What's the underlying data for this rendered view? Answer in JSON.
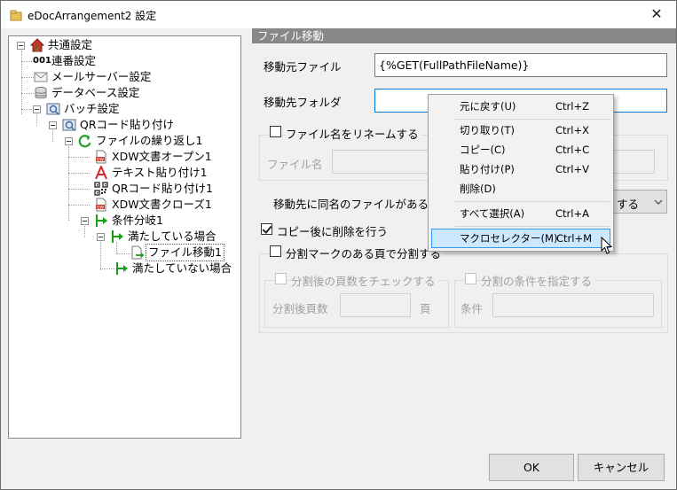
{
  "window": {
    "title": "eDocArrangement2 設定",
    "close_glyph": "✕"
  },
  "tree": {
    "items": [
      {
        "label": "共通設定",
        "icon": "common-settings-icon"
      },
      {
        "label": "連番設定",
        "icon_text": "001",
        "icon": "serial-number-icon"
      },
      {
        "label": "メールサーバー設定",
        "icon": "mail-icon"
      },
      {
        "label": "データベース設定",
        "icon": "database-icon"
      },
      {
        "label": "バッチ設定",
        "icon": "batch-icon"
      },
      {
        "label": "QRコード貼り付け",
        "icon": "batch-icon"
      },
      {
        "label": "ファイルの繰り返し1",
        "icon": "loop-icon"
      },
      {
        "label": "XDW文書オープン1",
        "icon": "xdw-doc-icon"
      },
      {
        "label": "テキスト貼り付け1",
        "icon": "text-a-icon"
      },
      {
        "label": "QRコード貼り付け1",
        "icon": "qr-code-icon"
      },
      {
        "label": "XDW文書クローズ1",
        "icon": "xdw-doc-icon"
      },
      {
        "label": "条件分岐1",
        "icon": "branch-icon"
      },
      {
        "label": "満たしている場合",
        "icon": "branch-icon"
      },
      {
        "label": "ファイル移動1",
        "icon": "file-move-icon"
      },
      {
        "label": "満たしていない場合",
        "icon": "branch-icon"
      }
    ]
  },
  "panel": {
    "header": "ファイル移動",
    "source_file_label": "移動元ファイル",
    "source_file_value": "{%GET(FullPathFileName)}",
    "dest_folder_label": "移動先フォルダ",
    "dest_folder_value": "",
    "rename_checkbox_label": "ファイル名をリネームする",
    "rename_checked": false,
    "filename_label": "ファイル名",
    "same_name_label": "移動先に同名のファイルがある",
    "same_name_combo_value": "する",
    "delete_after_copy_label": "コピー後に削除を行う",
    "delete_after_copy_checked": true,
    "split_checkbox_label": "分割マークのある頁で分割する",
    "split_checked": false,
    "check_pages_label": "分割後の頁数をチェックする",
    "pages_after_split_label": "分割後頁数",
    "page_unit": "頁",
    "split_condition_label": "分割の条件を指定する",
    "condition_label": "条件"
  },
  "buttons": {
    "ok": "OK",
    "cancel": "キャンセル"
  },
  "context_menu": {
    "items": [
      {
        "label": "元に戻す(U)",
        "shortcut": "Ctrl+Z"
      },
      {
        "label": "切り取り(T)",
        "shortcut": "Ctrl+X"
      },
      {
        "label": "コピー(C)",
        "shortcut": "Ctrl+C"
      },
      {
        "label": "貼り付け(P)",
        "shortcut": "Ctrl+V"
      },
      {
        "label": "削除(D)",
        "shortcut": ""
      },
      {
        "label": "すべて選択(A)",
        "shortcut": "Ctrl+A"
      },
      {
        "label": "マクロセレクター(M)",
        "shortcut": "Ctrl+M"
      }
    ],
    "highlighted_index": 6
  },
  "colors": {
    "section_header_bg": "#888888",
    "menu_highlight": "#cce8ff",
    "menu_highlight_border": "#3399ff",
    "branch_green": "#1a9e1a",
    "loop_green": "#2ca02c",
    "text_a_red": "#d62728"
  }
}
